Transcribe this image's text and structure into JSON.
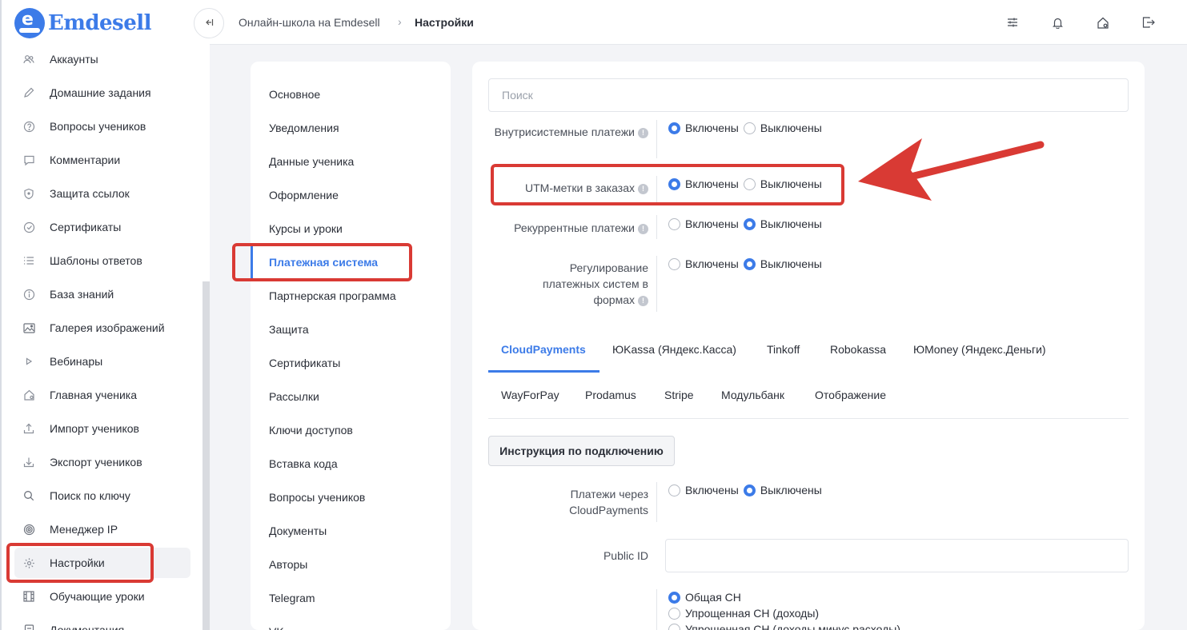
{
  "brand": {
    "name": "Emdesell",
    "logo_letter": "e"
  },
  "sidebar": {
    "items": [
      {
        "label": "Аккаунты",
        "icon": "users-icon"
      },
      {
        "label": "Домашние задания",
        "icon": "pencil-icon"
      },
      {
        "label": "Вопросы учеников",
        "icon": "question-icon"
      },
      {
        "label": "Комментарии",
        "icon": "comment-icon"
      },
      {
        "label": "Защита ссылок",
        "icon": "shield-icon"
      },
      {
        "label": "Сертификаты",
        "icon": "check-circle-icon"
      },
      {
        "label": "Шаблоны ответов",
        "icon": "list-icon"
      },
      {
        "label": "База знаний",
        "icon": "info-icon"
      },
      {
        "label": "Галерея изображений",
        "icon": "image-icon"
      },
      {
        "label": "Вебинары",
        "icon": "play-icon"
      },
      {
        "label": "Главная ученика",
        "icon": "home-icon"
      },
      {
        "label": "Импорт учеников",
        "icon": "upload-icon"
      },
      {
        "label": "Экспорт учеников",
        "icon": "download-icon"
      },
      {
        "label": "Поиск по ключу",
        "icon": "search-icon"
      },
      {
        "label": "Менеджер IP",
        "icon": "target-icon"
      },
      {
        "label": "Настройки",
        "icon": "gear-icon",
        "active": true
      },
      {
        "label": "Обучающие уроки",
        "icon": "film-icon"
      },
      {
        "label": "Документация",
        "icon": "doc-icon"
      }
    ]
  },
  "header": {
    "breadcrumb": [
      "Онлайн-школа на Emdesell",
      "Настройки"
    ],
    "icons": [
      "sliders-icon",
      "bell-icon",
      "home-settings-icon",
      "logout-icon"
    ]
  },
  "settings_menu": {
    "items": [
      "Основное",
      "Уведомления",
      "Данные ученика",
      "Оформление",
      "Курсы и уроки",
      "Платежная система",
      "Партнерская программа",
      "Защита",
      "Сертификаты",
      "Рассылки",
      "Ключи доступов",
      "Вставка кода",
      "Вопросы учеников",
      "Документы",
      "Авторы",
      "Telegram",
      "VK"
    ],
    "active": "Платежная система"
  },
  "main": {
    "search_placeholder": "Поиск",
    "on_label": "Включены",
    "off_label": "Выключены",
    "settings": [
      {
        "label": "Внутрисистемные платежи",
        "value": "on"
      },
      {
        "label": "UTM-метки в заказах",
        "value": "on"
      },
      {
        "label": "Рекуррентные платежи",
        "value": "off"
      },
      {
        "label": "Регулирование платежных систем в формах",
        "value": "off"
      }
    ],
    "tabs_row1": [
      "CloudPayments",
      "ЮKassa (Яндекс.Касса)",
      "Tinkoff",
      "Robokassa",
      "ЮMoney (Яндекс.Деньги)"
    ],
    "tabs_row2": [
      "WayForPay",
      "Prodamus",
      "Stripe",
      "Модульбанк",
      "Отображение"
    ],
    "active_tab": "CloudPayments",
    "instruction_button": "Инструкция по подключению",
    "cloudpayments_label": "Платежи через CloudPayments",
    "cloudpayments_value": "off",
    "public_id_label": "Public ID",
    "public_id_value": "",
    "tax_options": [
      "Общая СН",
      "Упрощенная СН (доходы)",
      "Упрощенная СН (доходы минус расходы)"
    ],
    "tax_selected": "Общая СН"
  },
  "annotation_color": "#d93a34",
  "accent_color": "#3c7be8"
}
